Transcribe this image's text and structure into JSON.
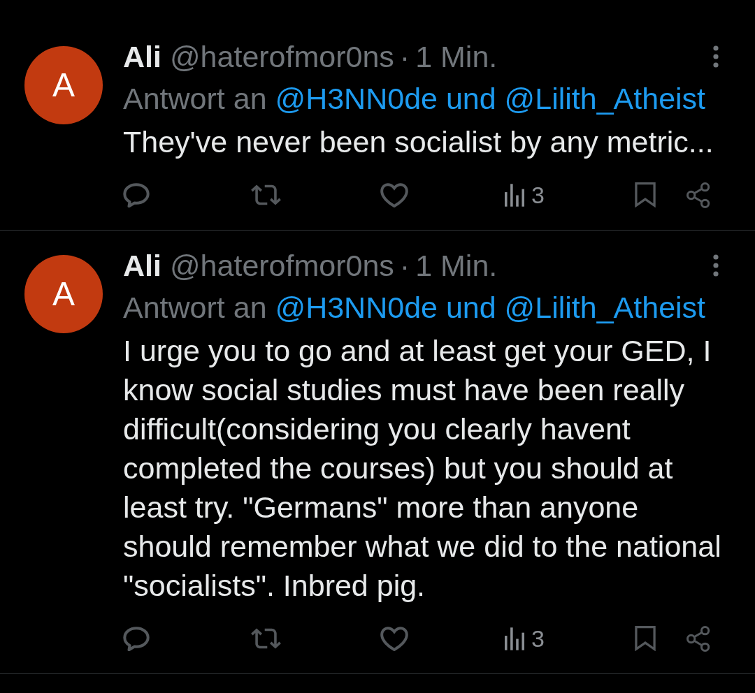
{
  "tweets": [
    {
      "avatar_letter": "A",
      "name": "Ali",
      "handle": "@haterofmor0ns",
      "separator": "·",
      "time": "1 Min.",
      "reply_prefix": "Antwort an",
      "reply_to": "@H3NN0de und @Lilith_Atheist",
      "text": "They've never been socialist by any metric...",
      "actions": [
        {
          "kind": "reply"
        },
        {
          "kind": "repost"
        },
        {
          "kind": "like"
        },
        {
          "kind": "views",
          "count": "3"
        },
        {
          "kind": "bookmark"
        },
        {
          "kind": "share"
        }
      ]
    },
    {
      "avatar_letter": "A",
      "name": "Ali",
      "handle": "@haterofmor0ns",
      "separator": "·",
      "time": "1 Min.",
      "reply_prefix": "Antwort an",
      "reply_to": "@H3NN0de und @Lilith_Atheist",
      "text": "I urge you to go and at least get your GED, I know social studies must have been really difficult(considering you clearly havent completed the courses) but you should at least try. \"Germans\" more than anyone should remember what we did to the national \"socialists\". Inbred pig.",
      "actions": [
        {
          "kind": "reply"
        },
        {
          "kind": "repost"
        },
        {
          "kind": "like"
        },
        {
          "kind": "views",
          "count": "3"
        },
        {
          "kind": "bookmark"
        },
        {
          "kind": "share"
        }
      ]
    }
  ]
}
